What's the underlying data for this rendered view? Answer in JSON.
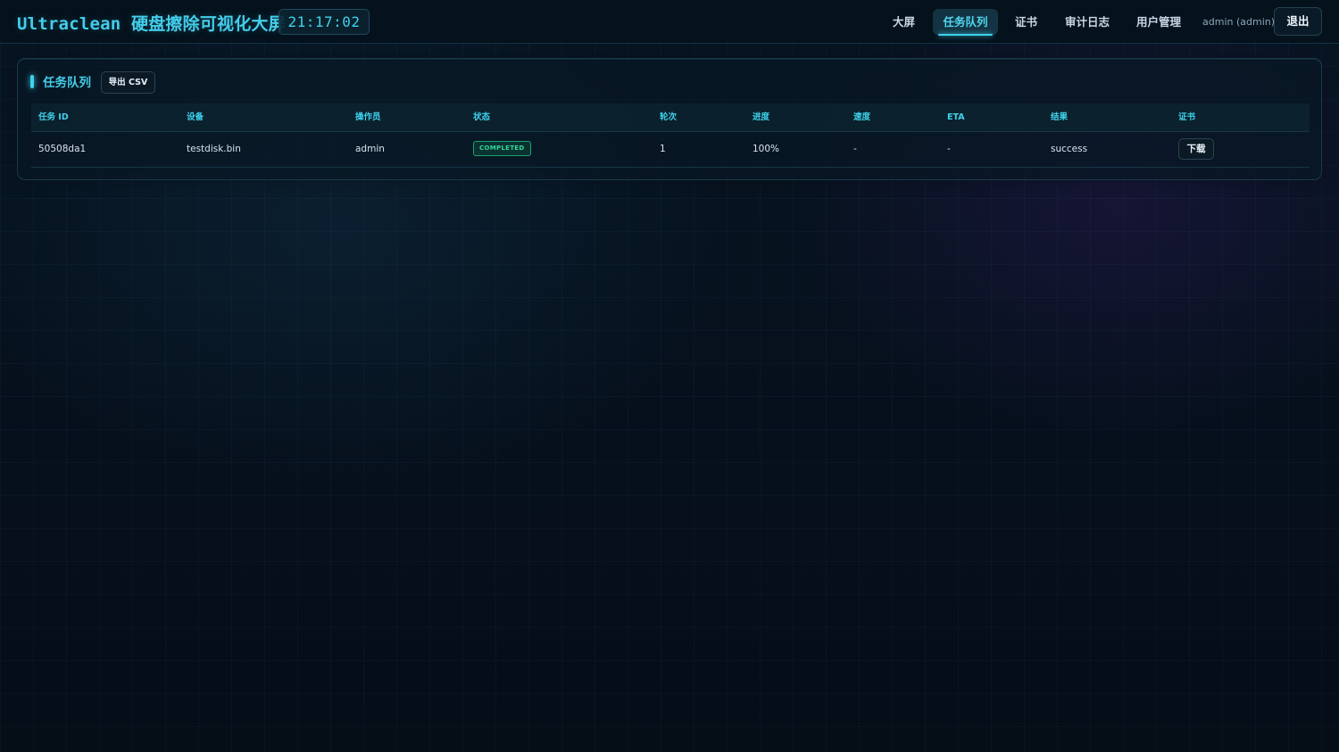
{
  "header": {
    "title": "Ultraclean 硬盘擦除可视化大屏",
    "clock": "21:17:02",
    "nav": [
      {
        "label": "大屏",
        "active": false
      },
      {
        "label": "任务队列",
        "active": true
      },
      {
        "label": "证书",
        "active": false
      },
      {
        "label": "审计日志",
        "active": false
      },
      {
        "label": "用户管理",
        "active": false
      }
    ],
    "user": "admin (admin)",
    "logout_label": "退出"
  },
  "panel": {
    "title": "任务队列",
    "export_label": "导出 CSV",
    "columns": [
      "任务 ID",
      "设备",
      "操作员",
      "状态",
      "轮次",
      "进度",
      "速度",
      "ETA",
      "结果",
      "证书"
    ],
    "rows": [
      {
        "task_id": "50508da1",
        "device": "testdisk.bin",
        "operator": "admin",
        "status": "COMPLETED",
        "pass": "1",
        "progress": "100%",
        "speed": "-",
        "eta": "-",
        "result": "success",
        "cert_action": "下载"
      }
    ]
  },
  "colors": {
    "accent": "#3fd2ec",
    "status_completed": "#2fd99c",
    "background": "#06111d"
  }
}
